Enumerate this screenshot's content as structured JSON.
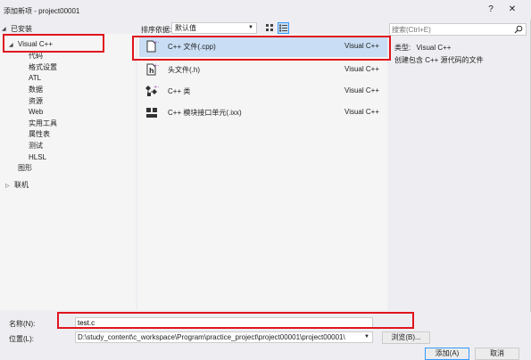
{
  "window": {
    "title": "添加新项 - project00001",
    "help_btn": "?",
    "close_btn": "✕"
  },
  "sidebar": {
    "installed_label": "已安装",
    "root_label": "Visual C++",
    "children": [
      "代码",
      "格式设置",
      "ATL",
      "数据",
      "资源",
      "Web",
      "实用工具",
      "属性表",
      "测试",
      "HLSL"
    ],
    "graphics_label": "图形",
    "online_label": "联机"
  },
  "toolbar": {
    "sort_label": "排序依据:",
    "sort_value": "默认值"
  },
  "templates": [
    {
      "name": "C++ 文件(.cpp)",
      "lang": "Visual C++",
      "icon": "cpp-file-icon",
      "selected": true
    },
    {
      "name": "头文件(.h)",
      "lang": "Visual C++",
      "icon": "header-file-icon",
      "selected": false
    },
    {
      "name": "C++ 类",
      "lang": "Visual C++",
      "icon": "cpp-class-icon",
      "selected": false
    },
    {
      "name": "C++ 模块接口单元(.ixx)",
      "lang": "Visual C++",
      "icon": "module-icon",
      "selected": false
    }
  ],
  "search": {
    "placeholder": "搜索(Ctrl+E)"
  },
  "details": {
    "type_label": "类型:",
    "type_value": "Visual C++",
    "description": "创建包含 C++ 源代码的文件"
  },
  "form": {
    "name_label": "名称(N):",
    "name_value": "test.c",
    "location_label": "位置(L):",
    "location_value": "D:\\study_content\\c_workspace\\Program\\practice_project\\project00001\\project00001\\",
    "browse_label": "浏览(B)...",
    "add_label": "添加(A)",
    "cancel_label": "取消"
  },
  "colors": {
    "selection_bg": "#c9def5",
    "highlight_border": "#e0141e",
    "accent": "#3399ff",
    "icon_purple": "#8b3aa9"
  }
}
